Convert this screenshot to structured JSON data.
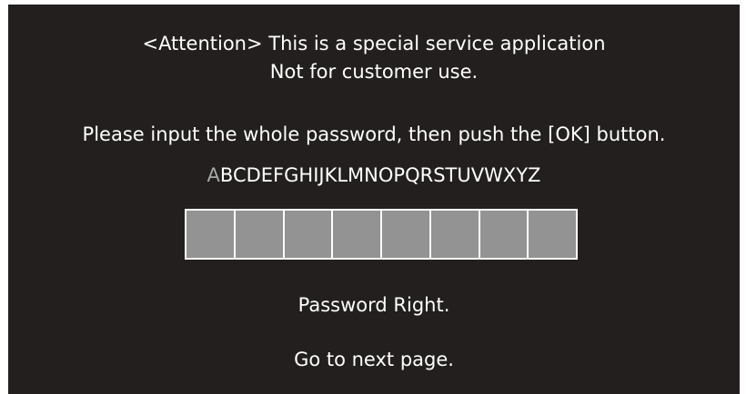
{
  "notice": {
    "line1": "<Attention> This is a special service application",
    "line2": "Not for customer use."
  },
  "instruction": "Please input the whole password, then push the [OK] button.",
  "alphabet": {
    "selected_letter": "A",
    "remaining_letters": "BCDEFGHIJKLMNOPQRSTUVWXYZ"
  },
  "password_cells": [
    "",
    "",
    "",
    "",
    "",
    "",
    "",
    ""
  ],
  "status": {
    "result": "Password Right.",
    "next": "Go to next page."
  },
  "colors": {
    "background": "#231f1f",
    "text": "#ffffff",
    "selected_letter": "#a8a8a8",
    "cell_fill": "#939393",
    "cell_border": "#ffffff"
  }
}
